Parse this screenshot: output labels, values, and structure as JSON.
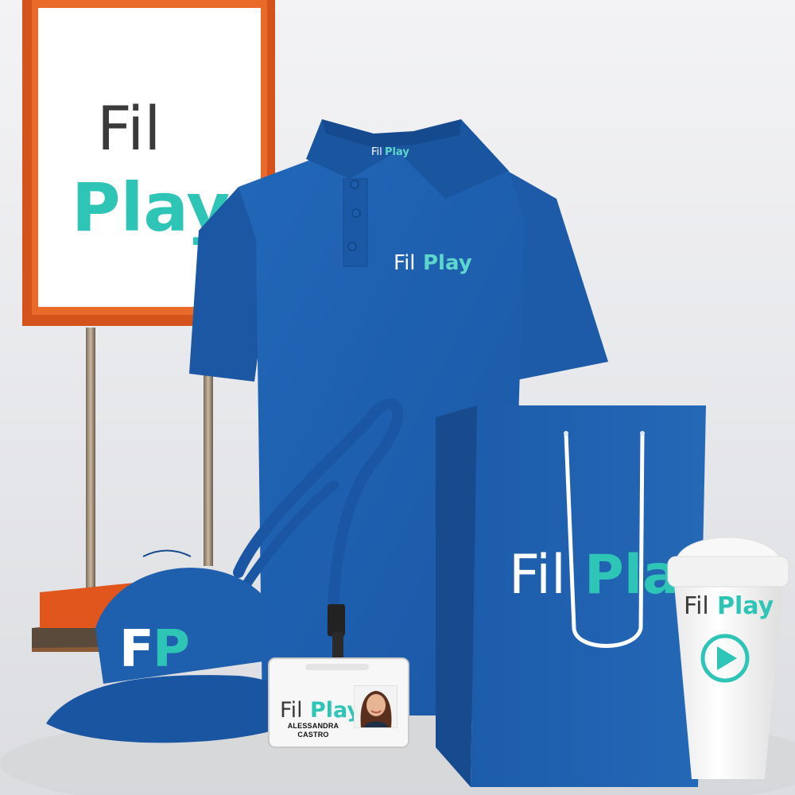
{
  "brand": {
    "part_1": "Fil",
    "part_2": "Play",
    "cap_monogram_1": "F",
    "cap_monogram_2": "P",
    "colors": {
      "brand_blue": "#1f5fae",
      "brand_teal": "#2ec4b6",
      "sign_frame": "#d9541c",
      "sign_text_dark": "#3a3a3a"
    }
  },
  "sign": {
    "line_1": "Fil",
    "line_2": "Play"
  },
  "badge": {
    "name_line_1": "ALESSANDRA",
    "name_line_2": "CASTRO"
  },
  "icons": {
    "cup_icon": "play-circle-icon"
  }
}
